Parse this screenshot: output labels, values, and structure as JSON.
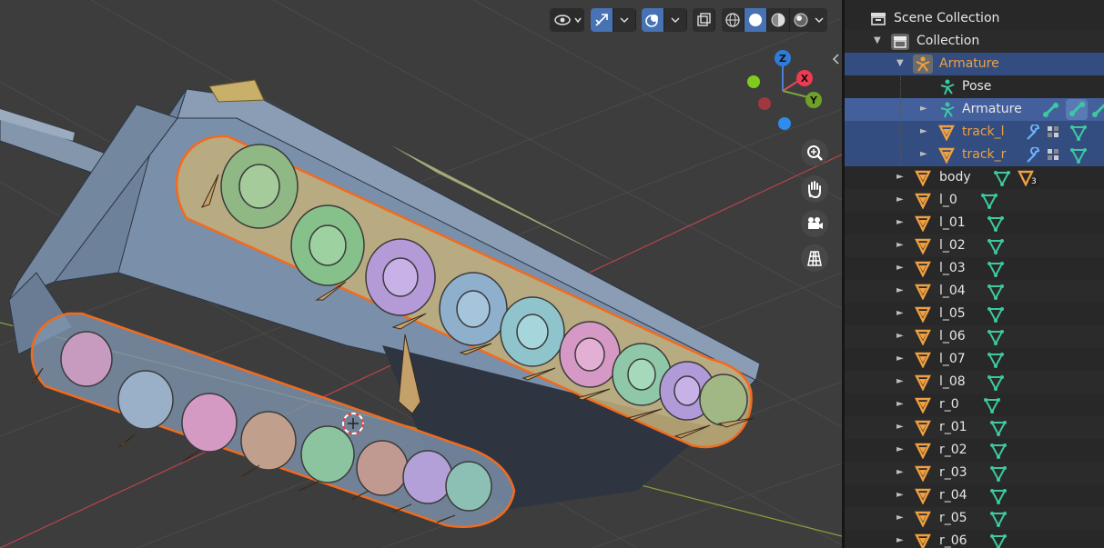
{
  "viewport": {
    "axes": {
      "z": "Z",
      "x": "X",
      "y": "Y"
    },
    "colors": {
      "track_outline": "#f26b1d",
      "tank_body": "#7a8fa9",
      "background": "#3d3d3d"
    },
    "header_icons": [
      "visibility-icon",
      "gizmo-icon",
      "overlay-icon",
      "xray-icon",
      "wireframe-shading-icon",
      "solid-shading-icon",
      "material-shading-icon",
      "rendered-shading-icon"
    ],
    "nav_icons": [
      "zoom-icon",
      "hand-pan-icon",
      "camera-icon",
      "grid-icon"
    ]
  },
  "outliner": {
    "rows": [
      {
        "label": "Scene Collection",
        "type": "collection"
      },
      {
        "label": "Collection",
        "type": "collection"
      },
      {
        "label": "Armature",
        "type": "armature-object"
      },
      {
        "label": "Pose",
        "type": "pose"
      },
      {
        "label": "Armature",
        "type": "armature-data"
      },
      {
        "label": "track_l",
        "type": "mesh"
      },
      {
        "label": "track_r",
        "type": "mesh"
      },
      {
        "label": "body",
        "type": "mesh",
        "badge": "3"
      },
      {
        "label": "l_0",
        "type": "mesh"
      },
      {
        "label": "l_01",
        "type": "mesh"
      },
      {
        "label": "l_02",
        "type": "mesh"
      },
      {
        "label": "l_03",
        "type": "mesh"
      },
      {
        "label": "l_04",
        "type": "mesh"
      },
      {
        "label": "l_05",
        "type": "mesh"
      },
      {
        "label": "l_06",
        "type": "mesh"
      },
      {
        "label": "l_07",
        "type": "mesh"
      },
      {
        "label": "l_08",
        "type": "mesh"
      },
      {
        "label": "r_0",
        "type": "mesh"
      },
      {
        "label": "r_01",
        "type": "mesh"
      },
      {
        "label": "r_02",
        "type": "mesh"
      },
      {
        "label": "r_03",
        "type": "mesh"
      },
      {
        "label": "r_04",
        "type": "mesh"
      },
      {
        "label": "r_05",
        "type": "mesh"
      },
      {
        "label": "r_06",
        "type": "mesh"
      }
    ]
  }
}
